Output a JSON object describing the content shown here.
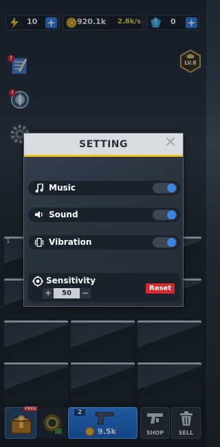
{
  "resources": {
    "energy": {
      "value": "10",
      "icon": "lightning-icon"
    },
    "coins": {
      "value": "920.1k",
      "rate": "2.8k/s",
      "icon": "coin-icon"
    },
    "gems": {
      "value": "0",
      "icon": "gem-icon"
    },
    "plus": "+"
  },
  "side": {
    "level_badge": "LV.8",
    "alert": "!"
  },
  "grid": {
    "first_slot_level": "1"
  },
  "bottom": {
    "chest_badge": "FREE",
    "buy_slot_level": "2",
    "buy_price": "9.5k",
    "shop_label": "SHOP",
    "sell_label": "SELL"
  },
  "modal": {
    "title": "SETTING",
    "close": "✕",
    "music_label": "Music",
    "sound_label": "Sound",
    "vibration_label": "Vibration",
    "sensitivity_label": "Sensitivity",
    "sensitivity_value": "50",
    "minus": "−",
    "reset_label": "Reset",
    "music_on": true,
    "sound_on": true,
    "vibration_on": true
  },
  "colors": {
    "accent_blue": "#2f7fe0",
    "header_stripe": "#f0c51e",
    "reset_red": "#d42a2e",
    "rate_yellow": "#e6d048"
  }
}
